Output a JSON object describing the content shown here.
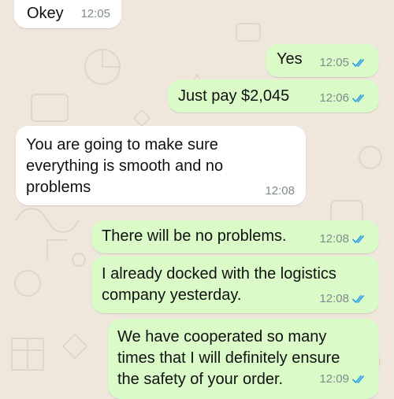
{
  "colors": {
    "wallpaper": "#efe6dc",
    "incoming_bubble": "#ffffff",
    "outgoing_bubble": "#dafbc8",
    "read_ticks": "#35a4e6",
    "timestamp": "#7d8a8e"
  },
  "icons": [
    "double-check-read-icon"
  ],
  "messages": [
    {
      "direction": "incoming",
      "text": "Okey",
      "time": "12:05"
    },
    {
      "direction": "outgoing",
      "text": "Yes",
      "time": "12:05",
      "status": "read"
    },
    {
      "direction": "outgoing",
      "text": "Just pay $2,045",
      "time": "12:06",
      "status": "read"
    },
    {
      "direction": "incoming",
      "text": "You are going to make sure\neverything is smooth and no\nproblems",
      "time": "12:08"
    },
    {
      "direction": "outgoing",
      "text": "There will be no problems.",
      "time": "12:08",
      "status": "read"
    },
    {
      "direction": "outgoing",
      "text": "I already docked with the logistics\ncompany yesterday.",
      "time": "12:08",
      "status": "read"
    },
    {
      "direction": "outgoing",
      "text": "We have cooperated so many\ntimes that I will definitely ensure\nthe safety of your order.",
      "time": "12:09",
      "status": "read"
    }
  ]
}
